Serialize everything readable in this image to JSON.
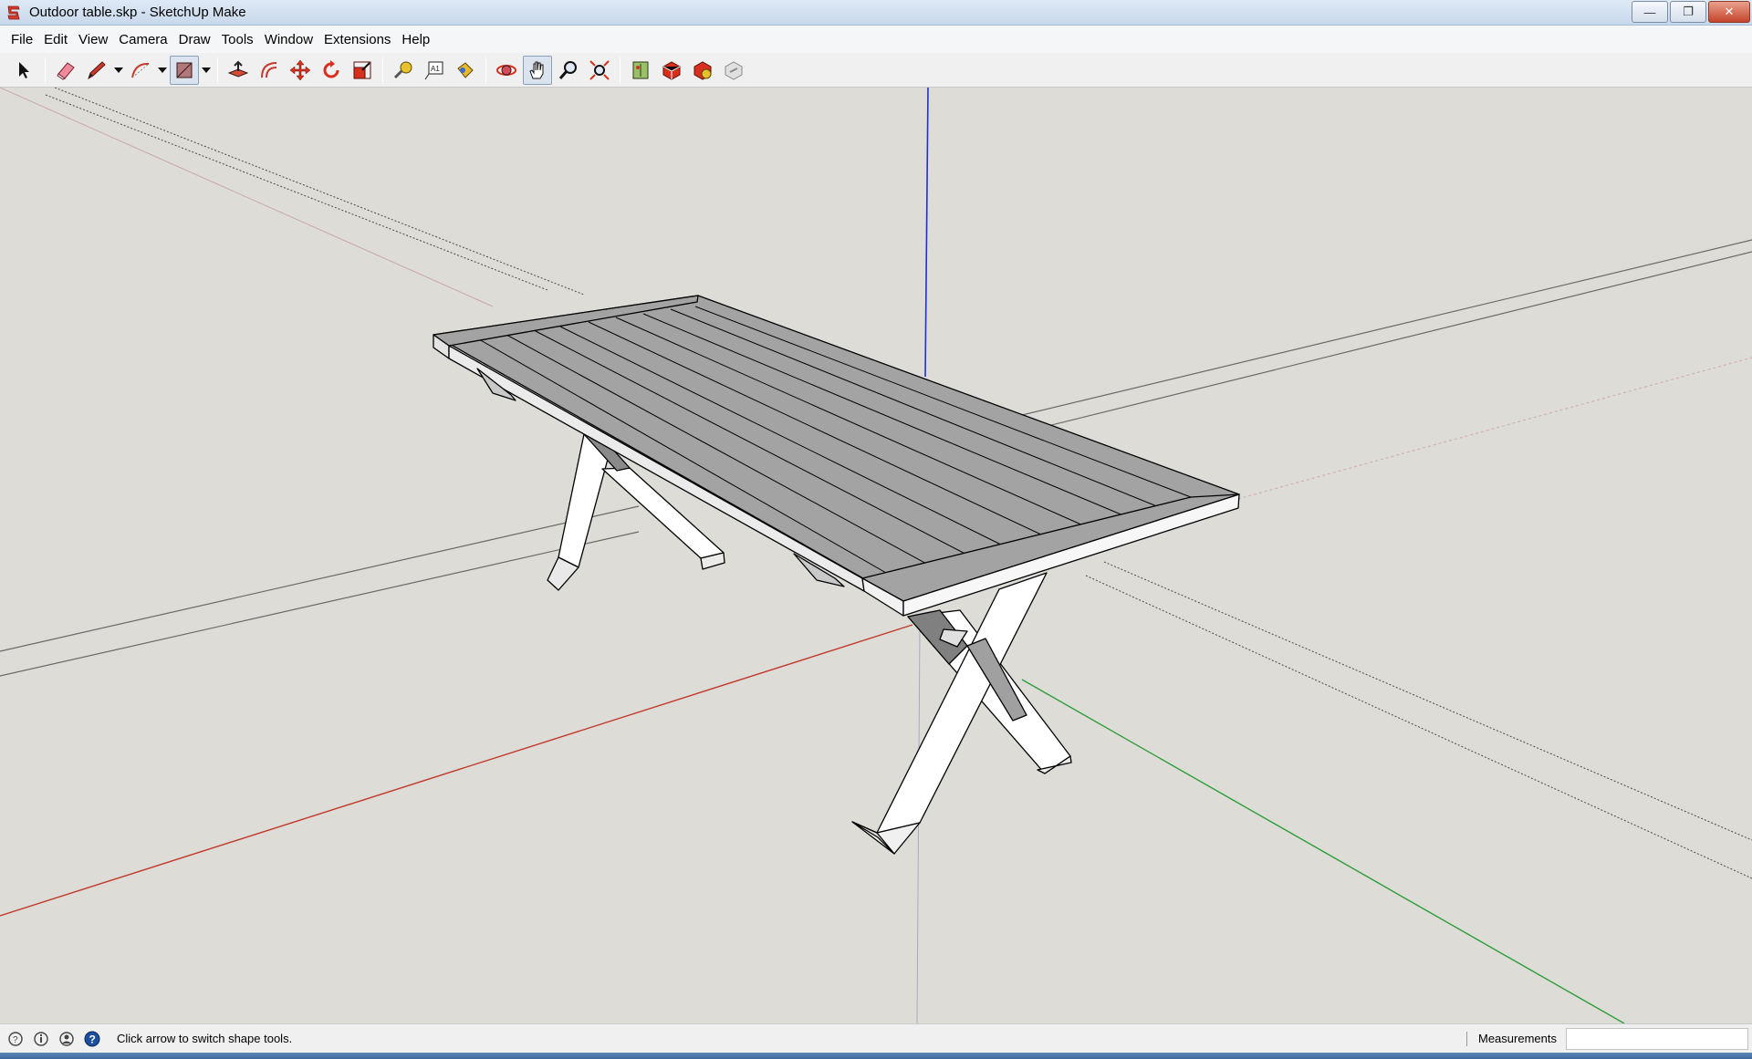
{
  "window": {
    "title": "Outdoor table.skp - SketchUp Make",
    "minimize_glyph": "—",
    "restore_glyph": "❐",
    "close_glyph": "✕"
  },
  "menu": [
    {
      "label": "File"
    },
    {
      "label": "Edit"
    },
    {
      "label": "View"
    },
    {
      "label": "Camera"
    },
    {
      "label": "Draw"
    },
    {
      "label": "Tools"
    },
    {
      "label": "Window"
    },
    {
      "label": "Extensions"
    },
    {
      "label": "Help"
    }
  ],
  "toolbar": {
    "tools": [
      {
        "name": "select-tool",
        "icon": "arrow-cursor-icon"
      },
      {
        "name": "eraser-tool",
        "icon": "eraser-icon"
      },
      {
        "name": "line-tool",
        "icon": "pencil-icon"
      },
      {
        "name": "arc-tool",
        "icon": "arc-icon"
      },
      {
        "name": "shape-tool",
        "icon": "rectangle-icon"
      },
      {
        "name": "push-pull-tool",
        "icon": "push-pull-icon"
      },
      {
        "name": "offset-tool",
        "icon": "offset-icon"
      },
      {
        "name": "move-tool",
        "icon": "move-icon"
      },
      {
        "name": "rotate-tool",
        "icon": "rotate-icon"
      },
      {
        "name": "scale-tool",
        "icon": "scale-icon"
      },
      {
        "name": "tape-measure-tool",
        "icon": "tape-measure-icon"
      },
      {
        "name": "text-tool",
        "icon": "text-icon"
      },
      {
        "name": "paint-bucket-tool",
        "icon": "paint-bucket-icon"
      },
      {
        "name": "orbit-tool",
        "icon": "orbit-icon"
      },
      {
        "name": "pan-tool",
        "icon": "hand-icon",
        "active": true
      },
      {
        "name": "zoom-tool",
        "icon": "magnifier-icon"
      },
      {
        "name": "zoom-extents-tool",
        "icon": "zoom-extents-icon"
      },
      {
        "name": "add-location-tool",
        "icon": "map-icon"
      },
      {
        "name": "3d-warehouse-tool",
        "icon": "warehouse-icon"
      },
      {
        "name": "extension-warehouse-tool",
        "icon": "extension-icon"
      },
      {
        "name": "share-model-tool",
        "icon": "share-icon"
      }
    ]
  },
  "status": {
    "hint": "Click arrow to switch shape tools.",
    "measurements_label": "Measurements",
    "measurements_value": ""
  },
  "colors": {
    "viewport_bg": "#dedcd6",
    "table_top": "#a3a3a3",
    "legs": "#ffffff",
    "red_axis": "#c0392b",
    "green_axis": "#2e9e3c",
    "blue_axis": "#1f2fd6"
  }
}
